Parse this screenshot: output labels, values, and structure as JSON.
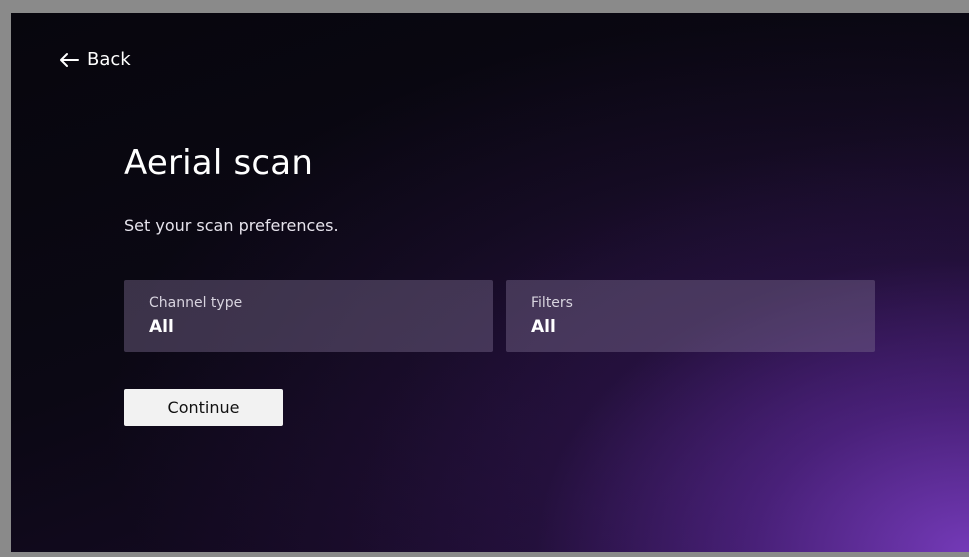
{
  "nav": {
    "back_label": "Back",
    "back_icon": "arrow-left-icon"
  },
  "page": {
    "title": "Aerial scan",
    "subtitle": "Set your scan preferences."
  },
  "options": [
    {
      "label": "Channel type",
      "value": "All"
    },
    {
      "label": "Filters",
      "value": "All"
    }
  ],
  "actions": {
    "continue_label": "Continue"
  },
  "colors": {
    "accent_purple": "#6a35b0",
    "background_dark": "#0b0814",
    "button_bg": "#f2f2f2"
  }
}
